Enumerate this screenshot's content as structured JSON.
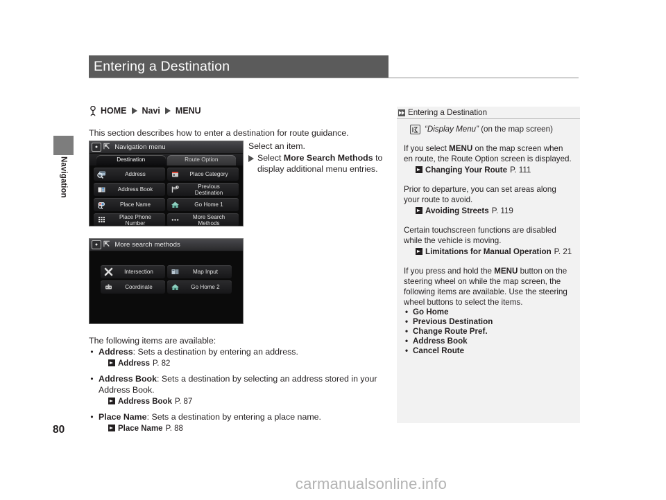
{
  "page": {
    "number": "80",
    "margin_label": "Navigation",
    "watermark": "carmanualsonline.info"
  },
  "header": {
    "title": "Entering a Destination"
  },
  "breadcrumb": {
    "hand_icon": "hand-pointer-icon",
    "items": [
      "HOME",
      "Navi",
      "MENU"
    ]
  },
  "intro": {
    "text": "This section describes how to enter a destination for route guidance."
  },
  "callout": {
    "line1": "Select an item.",
    "line2_prefix": "Select ",
    "line2_bold": "More Search Methods",
    "line2_suffix": " to display additional menu entries."
  },
  "screenshot1": {
    "title": "Navigation menu",
    "home_icon": "home-screen-icon",
    "back_icon": "back-arrow-icon",
    "tabs": [
      {
        "label": "Destination",
        "active": true
      },
      {
        "label": "Route Option",
        "active": false
      }
    ],
    "buttons": [
      {
        "label": "Address",
        "icon": "address-magnifier-icon"
      },
      {
        "label": "Place Category",
        "icon": "place-category-icon"
      },
      {
        "label": "Address Book",
        "icon": "address-book-icon"
      },
      {
        "label": "Previous\nDestination",
        "icon": "previous-destination-flag-icon"
      },
      {
        "label": "Place Name",
        "icon": "place-name-icon"
      },
      {
        "label": "Go Home 1",
        "icon": "home-house-icon"
      },
      {
        "label": "Place Phone\nNumber",
        "icon": "keypad-icon"
      },
      {
        "label": "More Search\nMethods",
        "icon": "more-dots-icon"
      }
    ]
  },
  "screenshot2": {
    "title": "More search methods",
    "home_icon": "home-screen-icon",
    "back_icon": "back-arrow-icon",
    "buttons": [
      {
        "label": "Intersection",
        "icon": "intersection-icon"
      },
      {
        "label": "Map Input",
        "icon": "map-input-icon"
      },
      {
        "label": "Coordinate",
        "icon": "coordinate-icon"
      },
      {
        "label": "Go Home 2",
        "icon": "home-house-icon"
      }
    ]
  },
  "items_section": {
    "intro": "The following items are available:",
    "items": [
      {
        "name": "Address",
        "description": ": Sets a destination by entering an address.",
        "ref_label": "Address",
        "ref_page": "P. 82"
      },
      {
        "name": "Address Book",
        "description": ": Sets a destination by selecting an address stored in your Address Book.",
        "ref_label": "Address Book",
        "ref_page": "P. 87"
      },
      {
        "name": "Place Name",
        "description": ": Sets a destination by entering a place name.",
        "ref_label": "Place Name",
        "ref_page": "P. 88"
      }
    ]
  },
  "sidebar": {
    "head_icon": "double-arrow-icon",
    "head_title": "Entering a Destination",
    "voice_icon": "voice-command-icon",
    "voice_command": "“Display Menu”",
    "voice_suffix": " (on the map screen)",
    "paragraphs": [
      {
        "pre": "If you select ",
        "bold": "MENU",
        "post": " on the map screen when en route, the Route Option screen is displayed.",
        "ref_label": "Changing Your Route",
        "ref_page": "P. 111"
      },
      {
        "pre": "Prior to departure, you can set areas along your route to avoid.",
        "bold": "",
        "post": "",
        "ref_label": "Avoiding Streets",
        "ref_page": "P. 119"
      },
      {
        "pre": "Certain touchscreen functions are disabled while the vehicle is moving.",
        "bold": "",
        "post": "",
        "ref_label": "Limitations for Manual Operation",
        "ref_page": "P. 21"
      }
    ],
    "final_paragraph": {
      "pre": "If you press and hold the ",
      "bold": "MENU",
      "post": " button on the steering wheel on while the map screen, the following items are available. Use the steering wheel buttons to select the items."
    },
    "bullets": [
      "Go Home",
      "Previous Destination",
      "Change Route Pref.",
      "Address Book",
      "Cancel Route"
    ]
  },
  "colors": {
    "header_bar": "#5b5b5b",
    "sidebar_bg": "#f2f2f2",
    "screen_bg": "#0b0b0b",
    "text": "#231f20",
    "watermark": "#b3b3b3"
  }
}
